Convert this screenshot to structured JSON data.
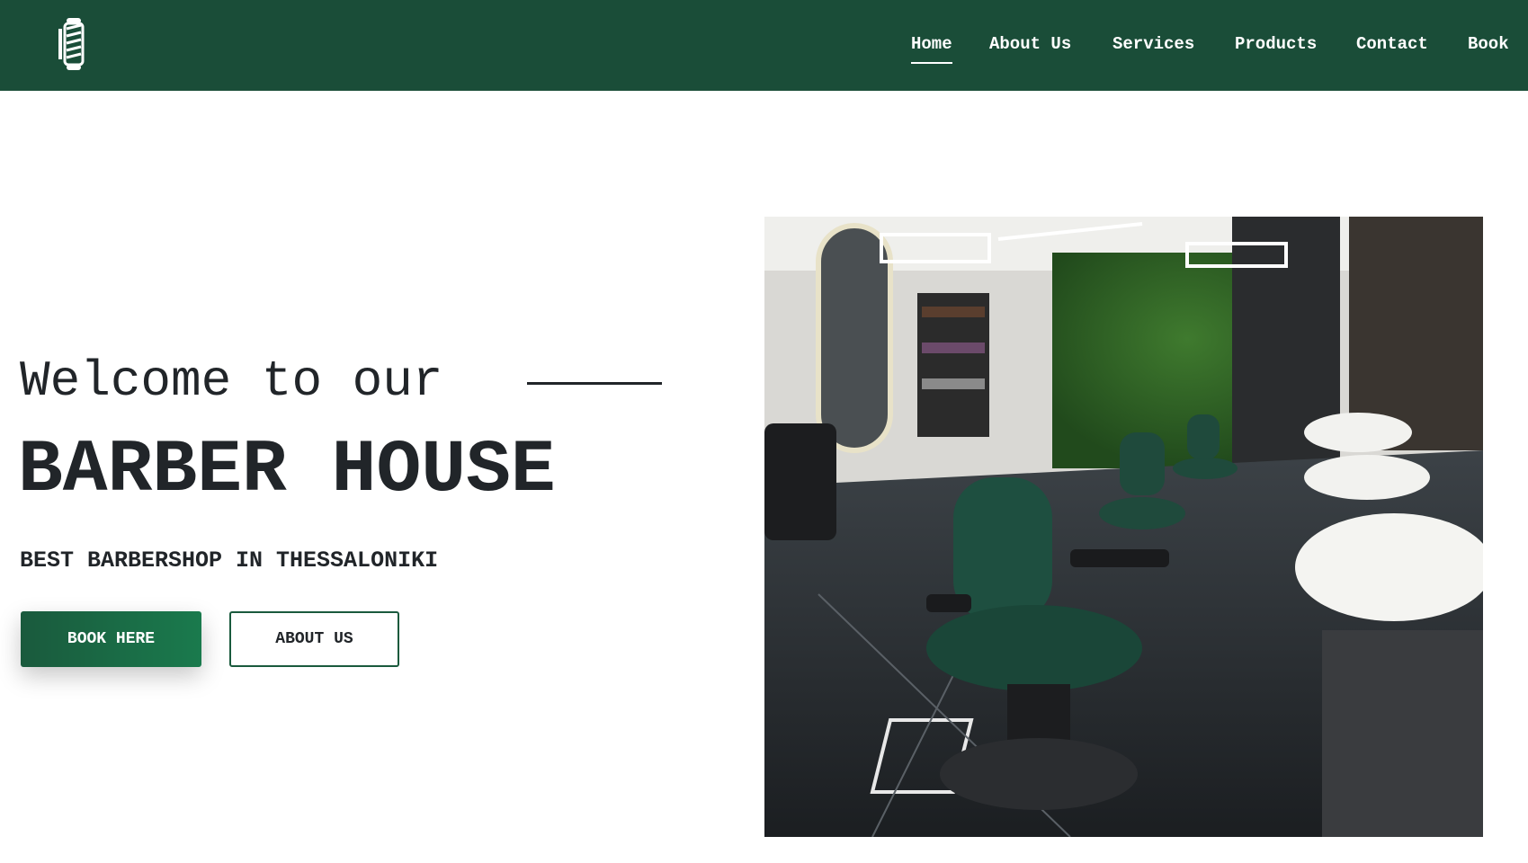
{
  "header": {
    "logo_icon": "barber-pole-icon",
    "bg_color": "#1a4d38",
    "nav": [
      {
        "label": "Home",
        "active": true
      },
      {
        "label": "About Us",
        "active": false
      },
      {
        "label": "Services",
        "active": false
      },
      {
        "label": "Products",
        "active": false
      },
      {
        "label": "Contact",
        "active": false
      },
      {
        "label": "Book",
        "active": false
      }
    ]
  },
  "hero": {
    "welcome": "Welcome to our",
    "title": "BARBER HOUSE",
    "subtitle": "BEST BARBERSHOP IN THESSALONIKI",
    "book_button": "BOOK HERE",
    "about_button": "ABOUT US",
    "accent_color": "#1a5a3d",
    "image": "barbershop-interior-photo"
  }
}
